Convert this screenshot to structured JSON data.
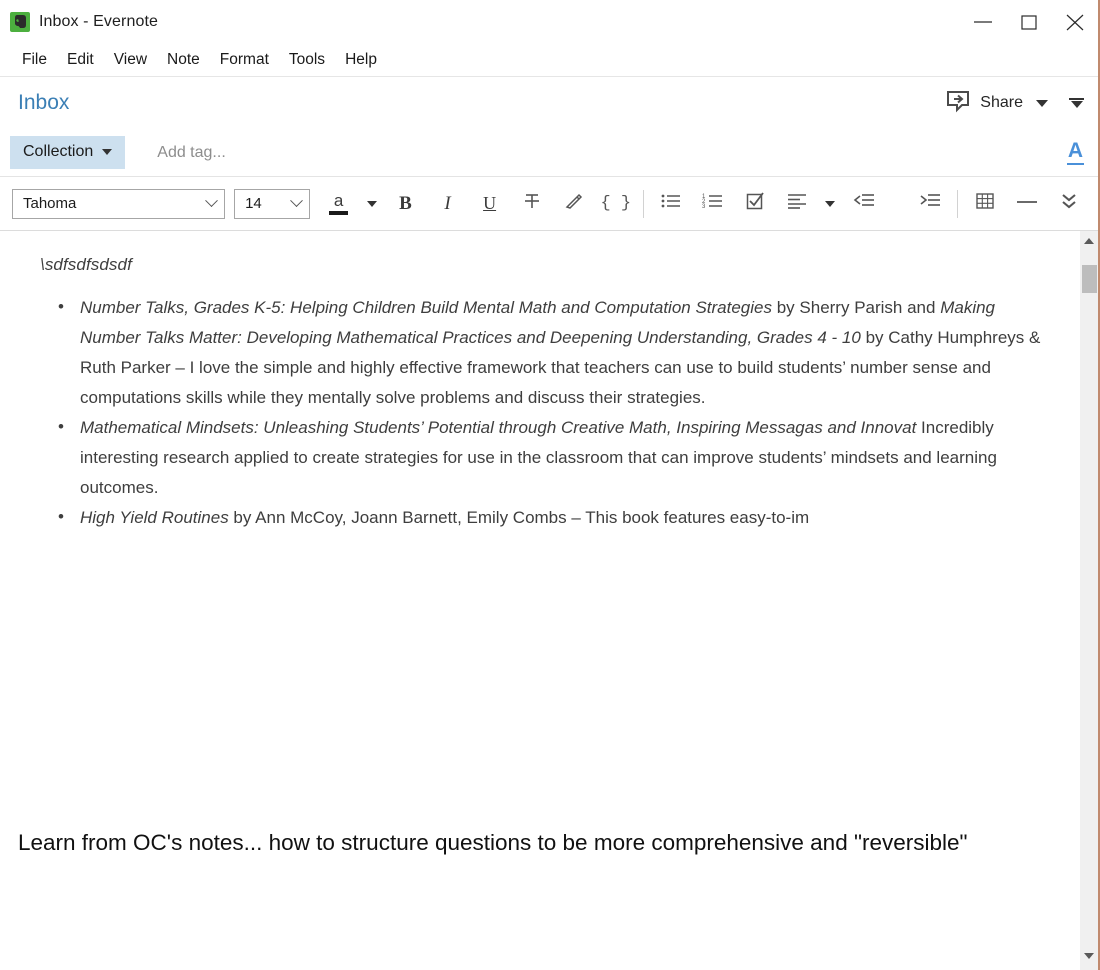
{
  "window": {
    "title": "Inbox - Evernote",
    "app_icon": "evernote-elephant-icon",
    "controls": {
      "minimize": "minimize",
      "maximize": "maximize",
      "close": "close"
    },
    "accent_green": "#4caf3f",
    "border_color": "#c08a6e"
  },
  "menubar": {
    "items": [
      "File",
      "Edit",
      "View",
      "Note",
      "Format",
      "Tools",
      "Help"
    ]
  },
  "note_header": {
    "title": "Inbox",
    "title_color": "#3b7fb5",
    "share_label": "Share",
    "share_icon": "share-icon",
    "share_dropdown_icon": "caret-down-icon",
    "more_icon": "double-caret-down-icon"
  },
  "tagbar": {
    "collection_label": "Collection",
    "collection_caret": "caret-down-icon",
    "collection_bg": "#cde0ef",
    "tag_placeholder": "Add tag...",
    "font_color_toggle": "A",
    "font_color_toggle_color": "#4a90d9"
  },
  "toolbar": {
    "font_family": "Tahoma",
    "font_size": "14",
    "buttons": [
      {
        "name": "text-color-button",
        "label": "a"
      },
      {
        "name": "text-color-dropdown",
        "label": ""
      },
      {
        "name": "bold-button",
        "label": "B"
      },
      {
        "name": "italic-button",
        "label": "I"
      },
      {
        "name": "underline-button",
        "label": "U"
      },
      {
        "name": "strikethrough-button",
        "label": ""
      },
      {
        "name": "highlight-button",
        "label": ""
      },
      {
        "name": "code-block-button",
        "label": "{ }"
      },
      {
        "name": "bulleted-list-button",
        "label": ""
      },
      {
        "name": "numbered-list-button",
        "label": ""
      },
      {
        "name": "checkbox-button",
        "label": ""
      },
      {
        "name": "align-left-button",
        "label": ""
      },
      {
        "name": "align-dropdown-button",
        "label": ""
      },
      {
        "name": "decrease-indent-button",
        "label": ""
      },
      {
        "name": "increase-indent-button",
        "label": ""
      },
      {
        "name": "insert-table-button",
        "label": ""
      },
      {
        "name": "horizontal-rule-button",
        "label": ""
      },
      {
        "name": "more-formatting-button",
        "label": ""
      }
    ]
  },
  "note_body": {
    "first_line": "\\sdfsdfsdsdf",
    "bullets": [
      {
        "segments": [
          {
            "text": "Number Talks, Grades K-5: Helping Children Build Mental Math and Computation Strategies",
            "italic": true
          },
          {
            "text": " by Sherry Parish and ",
            "italic": false
          },
          {
            "text": "Making Number Talks Matter: Developing Mathematical Practices and Deepening Understanding, Grades 4 - 10",
            "italic": true
          },
          {
            "text": " by Cathy Humphreys & Ruth Parker – I love the simple and highly effective framework that teachers can use to build students’ number sense and computations skills while they mentally solve problems and discuss their strategies.",
            "italic": false
          }
        ]
      },
      {
        "segments": [
          {
            "text": "Mathematical Mindsets: Unleashing Students’ Potential through Creative Math, Inspiring Messagas and Innovat",
            "italic": true
          },
          {
            "text": " Incredibly interesting research applied to create strategies for use in the classroom that can improve students’ mindsets and learning outcomes.",
            "italic": false
          }
        ]
      },
      {
        "segments": [
          {
            "text": "High Yield Routines",
            "italic": true
          },
          {
            "text": " by Ann McCoy, Joann Barnett, Emily Combs – This book features easy-to-im",
            "italic": false
          }
        ]
      }
    ],
    "bottom_paragraph": "Learn from OC's notes... how to structure questions to be more comprehensive and \"reversible\""
  },
  "scrollbar": {
    "up_arrow": "scroll-up-arrow-icon",
    "down_arrow": "scroll-down-arrow-icon",
    "thumb": "scrollbar-thumb"
  }
}
